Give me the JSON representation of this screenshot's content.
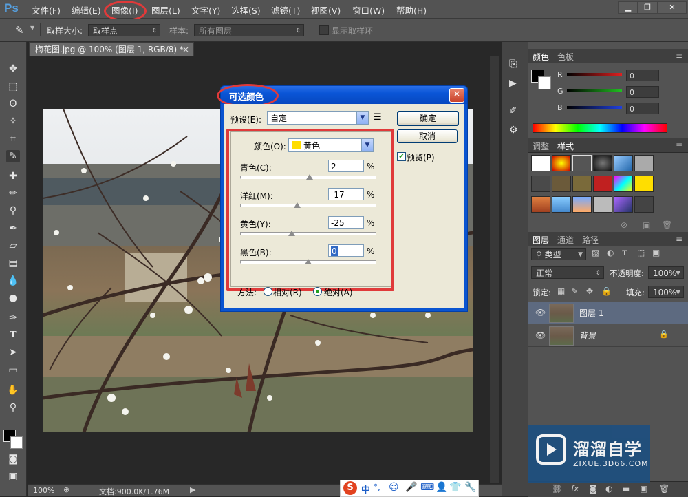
{
  "app": {
    "logo": "Ps"
  },
  "menubar": {
    "items": [
      "文件(F)",
      "编辑(E)",
      "图像(I)",
      "图层(L)",
      "文字(Y)",
      "选择(S)",
      "滤镜(T)",
      "视图(V)",
      "窗口(W)",
      "帮助(H)"
    ],
    "window_buttons": {
      "minimize": "▁",
      "restore": "❐",
      "close": "✕"
    }
  },
  "options_bar": {
    "sample_size_label": "取样大小:",
    "sample_size_value": "取样点",
    "sample_label": "样本:",
    "sample_value": "所有图层",
    "show_ring_label": "显示取样环"
  },
  "document": {
    "tab_title": "梅花图.jpg @ 100% (图层 1, RGB/8) *",
    "tab_close": "×",
    "zoom": "100%",
    "doc_info": "文档:900.0K/1.76M"
  },
  "color_panel": {
    "tabs": [
      "颜色",
      "色板"
    ],
    "channels": [
      {
        "label": "R",
        "value": "0",
        "color": "#e02020"
      },
      {
        "label": "G",
        "value": "0",
        "color": "#20c020"
      },
      {
        "label": "B",
        "value": "0",
        "color": "#2040e0"
      }
    ]
  },
  "styles_panel": {
    "tabs": [
      "调整",
      "样式"
    ]
  },
  "layers_panel": {
    "tabs": [
      "图层",
      "通道",
      "路径"
    ],
    "filter_kind": "类型",
    "blend_mode": "正常",
    "opacity_label": "不透明度:",
    "opacity_value": "100%",
    "lock_label": "锁定:",
    "fill_label": "填充:",
    "fill_value": "100%",
    "layers": [
      {
        "name": "图层 1",
        "selected": true
      },
      {
        "name": "背景",
        "selected": false
      }
    ]
  },
  "watermark": {
    "title": "溜溜自学",
    "url": "ZIXUE.3D66.COM"
  },
  "dialog": {
    "title": "可选颜色",
    "preset_label": "预设(E):",
    "preset_value": "自定",
    "ok_label": "确定",
    "cancel_label": "取消",
    "preview_label": "预览(P)",
    "preview_checked": true,
    "colors_label": "颜色(O):",
    "colors_value": "黄色",
    "colors_swatch": "#ffdd00",
    "sliders": [
      {
        "label": "青色(C):",
        "value": "2",
        "position": 0.51
      },
      {
        "label": "洋红(M):",
        "value": "-17",
        "position": 0.42
      },
      {
        "label": "黄色(Y):",
        "value": "-25",
        "position": 0.38
      },
      {
        "label": "黑色(B):",
        "value": "0",
        "position": 0.5
      }
    ],
    "percent": "%",
    "method_label": "方法:",
    "method_relative": "相对(R)",
    "method_absolute": "绝对(A)",
    "method_selected": "absolute"
  },
  "ime_bar": {
    "label": "中"
  },
  "colors": {
    "highlight_ring": "#e03a3a",
    "dialog_blue": "#0a54d0"
  }
}
